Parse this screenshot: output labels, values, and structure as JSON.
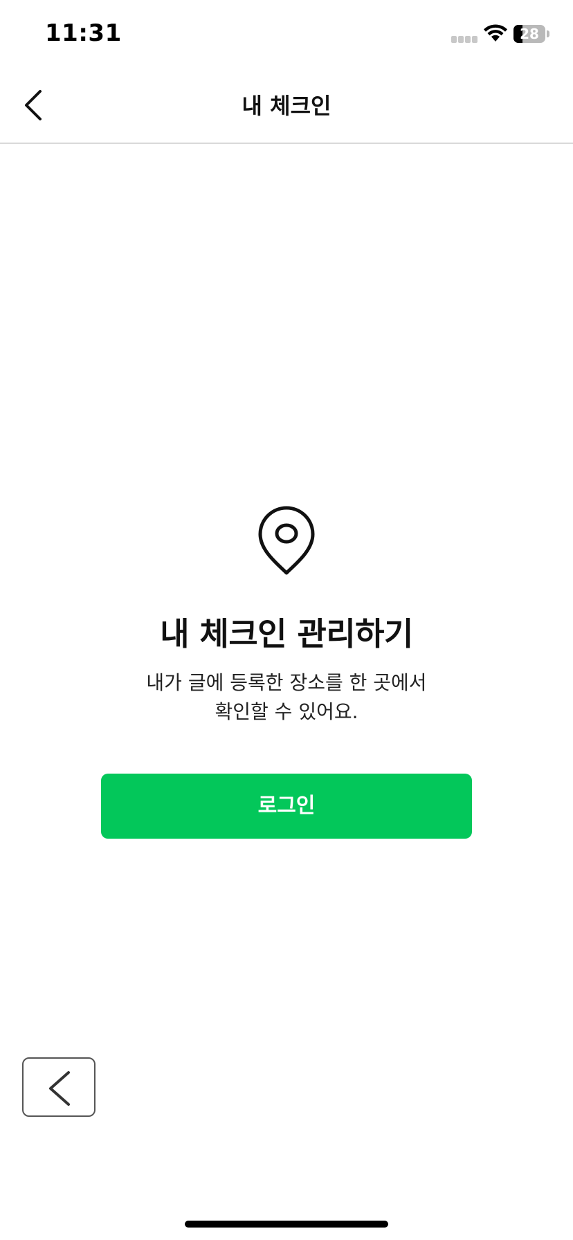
{
  "status_bar": {
    "time": "11:31",
    "battery_percent": 28,
    "battery_label": "28",
    "icons": [
      "signal-icon",
      "wifi-icon",
      "battery-icon"
    ]
  },
  "nav": {
    "title": "내 체크인",
    "back_icon": "chevron-left-icon"
  },
  "empty_state": {
    "icon": "map-pin-icon",
    "title": "내 체크인 관리하기",
    "description_line1": "내가 글에 등록한 장소를 한 곳에서",
    "description_line2": "확인할 수 있어요."
  },
  "login_button": {
    "label": "로그인"
  },
  "floating_back": {
    "icon": "chevron-left-icon"
  },
  "colors": {
    "accent": "#03c75a",
    "divider": "#d9d9d9",
    "text": "#111111"
  }
}
